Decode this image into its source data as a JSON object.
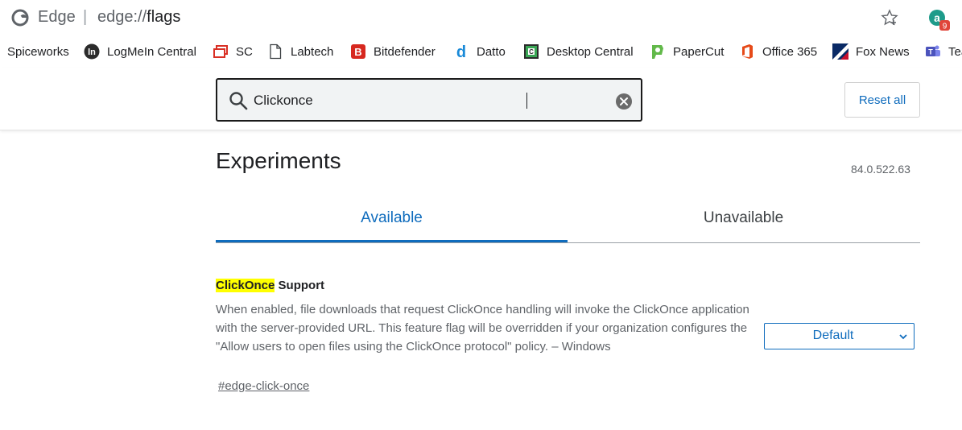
{
  "address_bar": {
    "browser_name": "Edge",
    "separator": "|",
    "url_scheme": "edge://",
    "url_path": "flags",
    "profile_badge": "9"
  },
  "favorites": [
    {
      "label": "Spiceworks",
      "icon": "spiceworks-icon"
    },
    {
      "label": "LogMeIn Central",
      "icon": "logmein-icon"
    },
    {
      "label": "SC",
      "icon": "screenconnect-icon"
    },
    {
      "label": "Labtech",
      "icon": "page-icon"
    },
    {
      "label": "Bitdefender",
      "icon": "bitdefender-icon"
    },
    {
      "label": "Datto",
      "icon": "datto-icon"
    },
    {
      "label": "Desktop Central",
      "icon": "desktop-central-icon"
    },
    {
      "label": "PaperCut",
      "icon": "papercut-icon"
    },
    {
      "label": "Office 365",
      "icon": "office-icon"
    },
    {
      "label": "Fox News",
      "icon": "fox-news-icon"
    },
    {
      "label": "Tea",
      "icon": "teams-icon"
    }
  ],
  "header": {
    "search_value": "Clickonce",
    "reset_label": "Reset all"
  },
  "main": {
    "title": "Experiments",
    "version": "84.0.522.63",
    "tabs": [
      {
        "label": "Available",
        "active": true
      },
      {
        "label": "Unavailable",
        "active": false
      }
    ]
  },
  "flag": {
    "title_highlight": "ClickOnce",
    "title_rest": " Support",
    "description": "When enabled, file downloads that request ClickOnce handling will invoke the ClickOnce application with the server-provided URL. This feature flag will be overridden if your organization configures the \"Allow users to open files using the ClickOnce protocol\" policy. – Windows",
    "link": "#edge-click-once",
    "select_value": "Default"
  },
  "colors": {
    "accent": "#0f6cbd",
    "highlight": "#ffff00",
    "search_border": "#1a1a1a"
  }
}
